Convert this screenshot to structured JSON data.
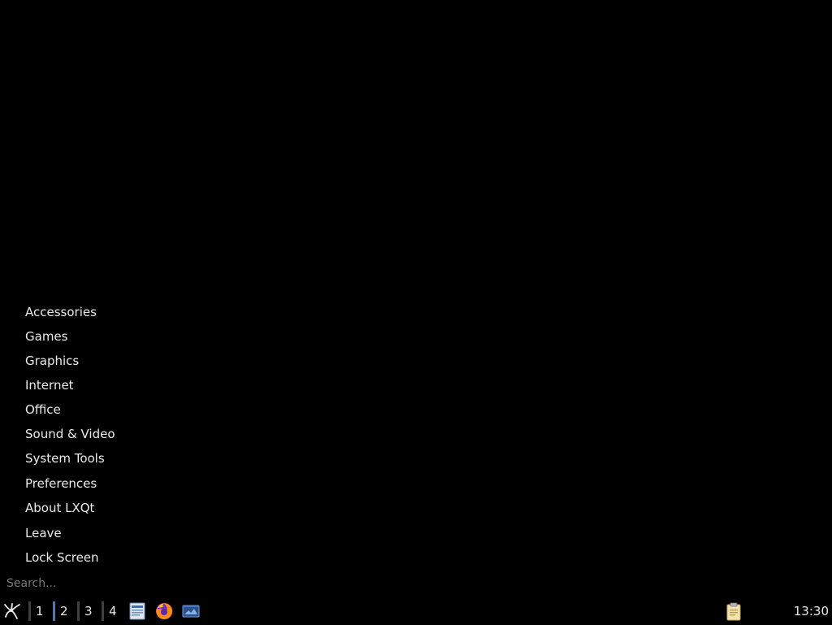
{
  "menu": {
    "items": [
      {
        "label": "Accessories"
      },
      {
        "label": "Games"
      },
      {
        "label": "Graphics"
      },
      {
        "label": "Internet"
      },
      {
        "label": "Office"
      },
      {
        "label": "Sound & Video"
      },
      {
        "label": "System Tools"
      },
      {
        "label": "Preferences"
      },
      {
        "label": "About LXQt"
      },
      {
        "label": "Leave"
      },
      {
        "label": "Lock Screen"
      }
    ],
    "search_placeholder": "Search..."
  },
  "panel": {
    "start_icon": "lxqt-start-icon",
    "desktops": [
      {
        "label": "1",
        "active": false
      },
      {
        "label": "2",
        "active": true
      },
      {
        "label": "3",
        "active": false
      },
      {
        "label": "4",
        "active": false
      }
    ],
    "launchers": [
      {
        "icon": "file-manager-icon"
      },
      {
        "icon": "firefox-icon"
      },
      {
        "icon": "show-desktop-icon"
      }
    ],
    "tray": [
      {
        "icon": "clipboard-icon"
      }
    ],
    "clock": "13:30",
    "accent_color": "#4a78c8"
  }
}
